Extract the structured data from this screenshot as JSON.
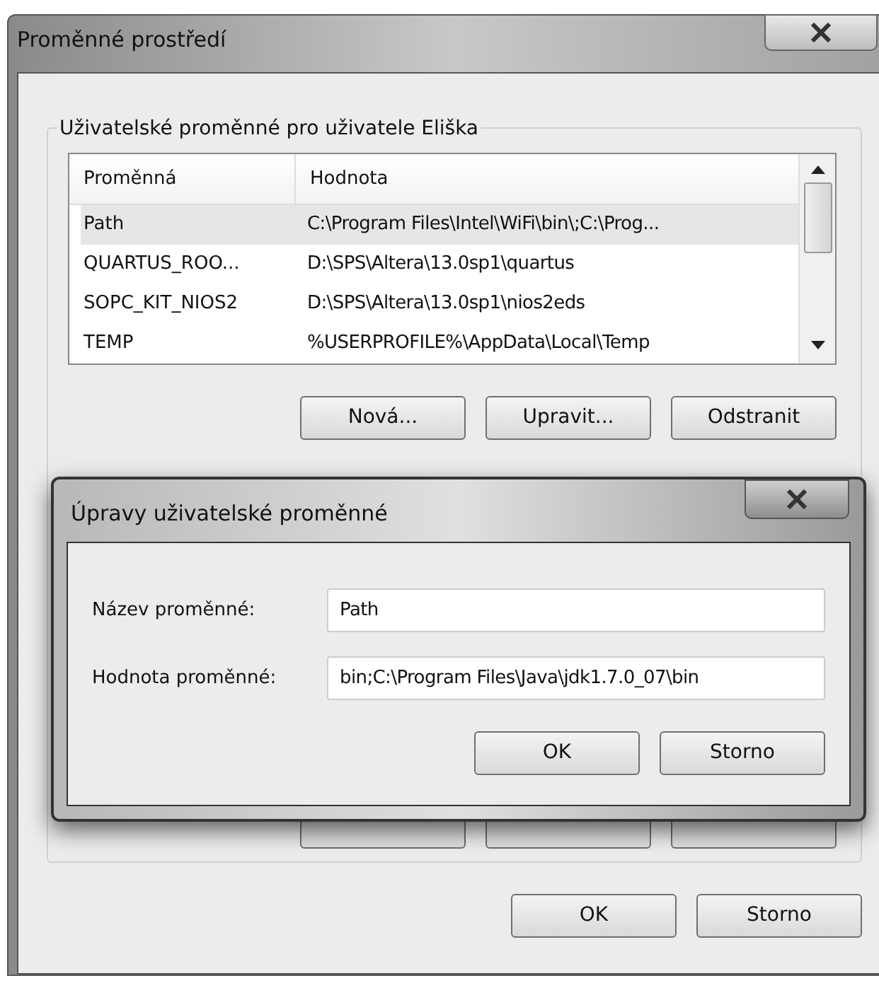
{
  "window": {
    "title": "Proměnné prostředí"
  },
  "user_vars": {
    "title": "Uživatelské proměnné pro uživatele Eliška",
    "columns": [
      "Proměnná",
      "Hodnota"
    ],
    "rows": [
      {
        "name": "Path",
        "value": "C:\\Program Files\\Intel\\WiFi\\bin\\;C:\\Prog...",
        "selected": true
      },
      {
        "name": "QUARTUS_ROO...",
        "value": "D:\\SPS\\Altera\\13.0sp1\\quartus",
        "selected": false
      },
      {
        "name": "SOPC_KIT_NIOS2",
        "value": "D:\\SPS\\Altera\\13.0sp1\\nios2eds",
        "selected": false
      },
      {
        "name": "TEMP",
        "value": "%USERPROFILE%\\AppData\\Local\\Temp",
        "selected": false
      }
    ],
    "buttons": [
      "Nová...",
      "Upravit...",
      "Odstranit"
    ]
  },
  "edit_dialog": {
    "title": "Úpravy uživatelské proměnné",
    "fields": [
      {
        "label": "Název proměnné:",
        "value": "Path"
      },
      {
        "label": "Hodnota proměnné:",
        "value": "bin;C:\\Program Files\\Java\\jdk1.7.0_07\\bin"
      }
    ],
    "buttons": [
      "OK",
      "Storno"
    ]
  },
  "buttons": [
    "OK",
    "Storno"
  ]
}
